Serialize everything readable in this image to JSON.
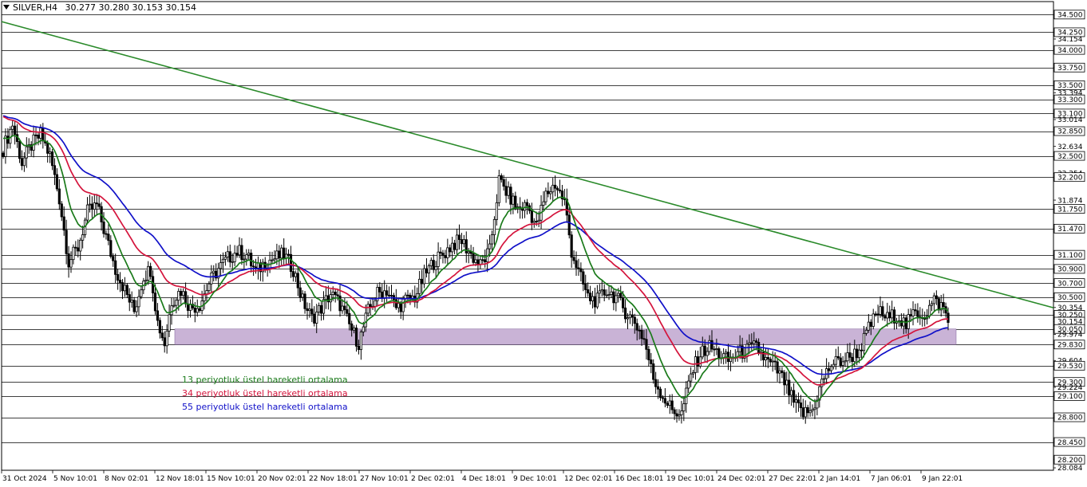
{
  "header": {
    "symbol": "SILVER,H4",
    "open": "30.277",
    "high": "30.280",
    "low": "30.153",
    "close": "30.154"
  },
  "legend": {
    "ema13": "13 periyotluk üstel hareketli ortalama",
    "ema34": "34 periyotluk üstel hareketli ortalama",
    "ema55": "55 periyotluk üstel hareketli ortalama"
  },
  "colors": {
    "ema13": "#1a7a1a",
    "ema34": "#d4143c",
    "ema55": "#1010c8",
    "trendline": "#2a8a2a",
    "zone": "#c9b3d6",
    "candle": "#000000",
    "level_line": "#000000"
  },
  "chart_data": {
    "type": "candlestick",
    "ylim": [
      28.084,
      34.65
    ],
    "y_ticks": [
      "34.500",
      "34.250",
      "34.154",
      "34.000",
      "33.750",
      "33.500",
      "33.394",
      "33.300",
      "33.100",
      "33.014",
      "32.850",
      "32.634",
      "32.500",
      "32.254",
      "32.200",
      "31.874",
      "31.750",
      "31.470",
      "31.100",
      "30.900",
      "30.700",
      "30.500",
      "30.354",
      "30.250",
      "30.154",
      "30.050",
      "29.974",
      "29.830",
      "29.604",
      "29.530",
      "29.300",
      "29.224",
      "29.100",
      "28.800",
      "28.450",
      "28.200",
      "28.084"
    ],
    "boxed_ticks": [
      "34.500",
      "34.250",
      "34.000",
      "33.750",
      "33.500",
      "33.300",
      "33.100",
      "32.850",
      "32.500",
      "32.200",
      "31.750",
      "31.470",
      "31.100",
      "30.900",
      "30.700",
      "30.500",
      "30.250",
      "30.154",
      "30.050",
      "29.830",
      "29.530",
      "29.300",
      "29.100",
      "28.800",
      "28.450",
      "28.200"
    ],
    "horizontal_levels": [
      34.5,
      34.25,
      34.0,
      33.75,
      33.5,
      33.3,
      33.1,
      32.85,
      32.5,
      32.2,
      31.75,
      31.47,
      31.1,
      30.9,
      30.7,
      30.5,
      30.25,
      30.05,
      29.83,
      29.53,
      29.3,
      29.1,
      28.8,
      28.45
    ],
    "x_labels": [
      "31 Oct 2024",
      "5 Nov 10:01",
      "8 Nov 02:01",
      "12 Nov 18:01",
      "15 Nov 10:01",
      "20 Nov 02:01",
      "22 Nov 18:01",
      "27 Nov 10:01",
      "2 Dec 02:01",
      "4 Dec 18:01",
      "9 Dec 10:01",
      "12 Dec 02:01",
      "16 Dec 18:01",
      "19 Dec 10:01",
      "24 Dec 02:01",
      "27 Dec 22:01",
      "2 Jan 14:01",
      "7 Jan 06:01",
      "9 Jan 22:01"
    ],
    "support_zone": {
      "from": 29.83,
      "to": 30.05
    },
    "trendline": {
      "start": 34.4,
      "end": 30.35
    },
    "close_anchors": [
      [
        0,
        32.6
      ],
      [
        4,
        32.95
      ],
      [
        8,
        32.4
      ],
      [
        12,
        32.65
      ],
      [
        16,
        32.8
      ],
      [
        20,
        32.5
      ],
      [
        24,
        31.9
      ],
      [
        28,
        31.0
      ],
      [
        32,
        31.2
      ],
      [
        36,
        31.7
      ],
      [
        40,
        31.8
      ],
      [
        44,
        31.35
      ],
      [
        48,
        30.9
      ],
      [
        52,
        30.6
      ],
      [
        56,
        30.3
      ],
      [
        60,
        30.8
      ],
      [
        63,
        30.9
      ],
      [
        66,
        30.15
      ],
      [
        69,
        29.85
      ],
      [
        72,
        30.45
      ],
      [
        76,
        30.6
      ],
      [
        80,
        30.35
      ],
      [
        84,
        30.4
      ],
      [
        88,
        30.7
      ],
      [
        92,
        30.9
      ],
      [
        96,
        31.05
      ],
      [
        100,
        31.15
      ],
      [
        104,
        31.1
      ],
      [
        108,
        30.85
      ],
      [
        112,
        31.0
      ],
      [
        116,
        31.05
      ],
      [
        120,
        31.1
      ],
      [
        124,
        30.9
      ],
      [
        128,
        30.45
      ],
      [
        132,
        30.2
      ],
      [
        136,
        30.35
      ],
      [
        140,
        30.55
      ],
      [
        144,
        30.4
      ],
      [
        148,
        30.1
      ],
      [
        152,
        29.85
      ],
      [
        156,
        30.3
      ],
      [
        160,
        30.55
      ],
      [
        164,
        30.6
      ],
      [
        168,
        30.35
      ],
      [
        172,
        30.45
      ],
      [
        176,
        30.5
      ],
      [
        180,
        30.8
      ],
      [
        184,
        31.0
      ],
      [
        188,
        31.1
      ],
      [
        192,
        31.25
      ],
      [
        196,
        31.3
      ],
      [
        200,
        31.1
      ],
      [
        204,
        30.95
      ],
      [
        208,
        31.15
      ],
      [
        212,
        32.15
      ],
      [
        216,
        31.95
      ],
      [
        220,
        31.75
      ],
      [
        224,
        31.8
      ],
      [
        228,
        31.5
      ],
      [
        232,
        31.95
      ],
      [
        236,
        32.1
      ],
      [
        240,
        31.85
      ],
      [
        243,
        31.15
      ],
      [
        246,
        30.85
      ],
      [
        250,
        30.5
      ],
      [
        254,
        30.45
      ],
      [
        258,
        30.6
      ],
      [
        262,
        30.5
      ],
      [
        266,
        30.3
      ],
      [
        270,
        30.15
      ],
      [
        274,
        29.9
      ],
      [
        278,
        29.35
      ],
      [
        282,
        29.1
      ],
      [
        286,
        28.9
      ],
      [
        290,
        28.85
      ],
      [
        294,
        29.4
      ],
      [
        298,
        29.7
      ],
      [
        302,
        29.8
      ],
      [
        306,
        29.7
      ],
      [
        310,
        29.6
      ],
      [
        314,
        29.7
      ],
      [
        318,
        29.75
      ],
      [
        322,
        29.8
      ],
      [
        326,
        29.6
      ],
      [
        330,
        29.5
      ],
      [
        334,
        29.3
      ],
      [
        338,
        29.0
      ],
      [
        342,
        28.85
      ],
      [
        346,
        28.9
      ],
      [
        350,
        29.3
      ],
      [
        354,
        29.55
      ],
      [
        358,
        29.6
      ],
      [
        362,
        29.65
      ],
      [
        366,
        29.75
      ],
      [
        370,
        30.05
      ],
      [
        374,
        30.3
      ],
      [
        378,
        30.2
      ],
      [
        382,
        30.25
      ],
      [
        386,
        30.1
      ],
      [
        390,
        30.3
      ],
      [
        394,
        30.25
      ],
      [
        398,
        30.45
      ],
      [
        402,
        30.35
      ],
      [
        404,
        30.15
      ]
    ]
  }
}
